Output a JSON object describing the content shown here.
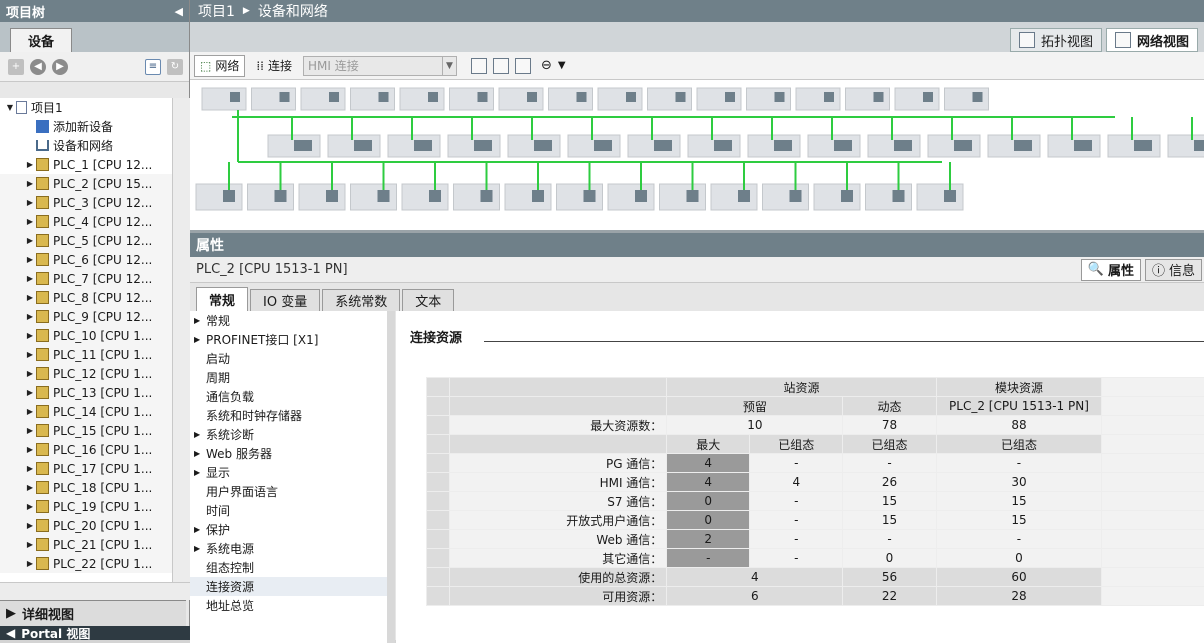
{
  "left_panel": {
    "title": "项目树",
    "device_tab": "设备",
    "tree": [
      {
        "label": "项目1",
        "kind": "project"
      },
      {
        "label": "添加新设备",
        "kind": "add"
      },
      {
        "label": "设备和网络",
        "kind": "network"
      },
      {
        "label": "PLC_1 [CPU 12...",
        "kind": "plc"
      },
      {
        "label": "PLC_2 [CPU 15...",
        "kind": "plc"
      },
      {
        "label": "PLC_3 [CPU 12...",
        "kind": "plc"
      },
      {
        "label": "PLC_4 [CPU 12...",
        "kind": "plc"
      },
      {
        "label": "PLC_5 [CPU 12...",
        "kind": "plc"
      },
      {
        "label": "PLC_6 [CPU 12...",
        "kind": "plc"
      },
      {
        "label": "PLC_7 [CPU 12...",
        "kind": "plc"
      },
      {
        "label": "PLC_8 [CPU 12...",
        "kind": "plc"
      },
      {
        "label": "PLC_9 [CPU 12...",
        "kind": "plc"
      },
      {
        "label": "PLC_10 [CPU 1...",
        "kind": "plc"
      },
      {
        "label": "PLC_11 [CPU 1...",
        "kind": "plc"
      },
      {
        "label": "PLC_12 [CPU 1...",
        "kind": "plc"
      },
      {
        "label": "PLC_13 [CPU 1...",
        "kind": "plc"
      },
      {
        "label": "PLC_14 [CPU 1...",
        "kind": "plc"
      },
      {
        "label": "PLC_15 [CPU 1...",
        "kind": "plc"
      },
      {
        "label": "PLC_16 [CPU 1...",
        "kind": "plc"
      },
      {
        "label": "PLC_17 [CPU 1...",
        "kind": "plc"
      },
      {
        "label": "PLC_18 [CPU 1...",
        "kind": "plc"
      },
      {
        "label": "PLC_19 [CPU 1...",
        "kind": "plc"
      },
      {
        "label": "PLC_20 [CPU 1...",
        "kind": "plc"
      },
      {
        "label": "PLC_21 [CPU 1...",
        "kind": "plc"
      },
      {
        "label": "PLC_22 [CPU 1...",
        "kind": "plc"
      }
    ],
    "detail_view": "详细视图",
    "portal_view": "Portal 视图"
  },
  "main": {
    "breadcrumb": [
      "项目1",
      "设备和网络"
    ],
    "topology_view": "拓扑视图",
    "network_view": "网络视图",
    "network_btn": "网络",
    "connection_btn": "连接",
    "hmi_select": "HMI 连接"
  },
  "properties": {
    "title": "属性",
    "device": "PLC_2 [CPU 1513-1 PN]",
    "props_tab": "属性",
    "info_tab": "信息",
    "tabs": [
      "常规",
      "IO 变量",
      "系统常数",
      "文本"
    ],
    "nav": [
      {
        "label": "常规",
        "expand": true
      },
      {
        "label": "PROFINET接口 [X1]",
        "expand": true
      },
      {
        "label": "启动",
        "expand": false
      },
      {
        "label": "周期",
        "expand": false
      },
      {
        "label": "通信负载",
        "expand": false
      },
      {
        "label": "系统和时钟存储器",
        "expand": false
      },
      {
        "label": "系统诊断",
        "expand": true
      },
      {
        "label": "Web 服务器",
        "expand": true
      },
      {
        "label": "显示",
        "expand": true
      },
      {
        "label": "用户界面语言",
        "expand": false
      },
      {
        "label": "时间",
        "expand": false
      },
      {
        "label": "保护",
        "expand": true
      },
      {
        "label": "系统电源",
        "expand": true
      },
      {
        "label": "组态控制",
        "expand": false
      },
      {
        "label": "连接资源",
        "expand": false
      },
      {
        "label": "地址总览",
        "expand": false
      }
    ],
    "section_title": "连接资源",
    "table": {
      "station_resources": "站资源",
      "module_resources": "模块资源",
      "reserved": "预留",
      "dynamic": "动态",
      "module_name": "PLC_2 [CPU 1513-1 PN]",
      "max_label": "最大资源数：",
      "max_values": [
        "10",
        "78",
        "88"
      ],
      "h_max": "最大",
      "h_cfg": "已组态",
      "rows": [
        {
          "label": "PG 通信：",
          "max": "4",
          "cfg": "-",
          "dyn": "-",
          "mod": "-"
        },
        {
          "label": "HMI 通信：",
          "max": "4",
          "cfg": "4",
          "dyn": "26",
          "mod": "30"
        },
        {
          "label": "S7 通信：",
          "max": "0",
          "cfg": "-",
          "dyn": "15",
          "mod": "15"
        },
        {
          "label": "开放式用户通信：",
          "max": "0",
          "cfg": "-",
          "dyn": "15",
          "mod": "15"
        },
        {
          "label": "Web 通信：",
          "max": "2",
          "cfg": "-",
          "dyn": "-",
          "mod": "-"
        },
        {
          "label": "其它通信：",
          "max": "-",
          "cfg": "-",
          "dyn": "0",
          "mod": "0"
        }
      ],
      "total_label": "使用的总资源：",
      "total": [
        "4",
        "56",
        "60"
      ],
      "avail_label": "可用资源：",
      "avail": [
        "6",
        "22",
        "28"
      ]
    }
  }
}
